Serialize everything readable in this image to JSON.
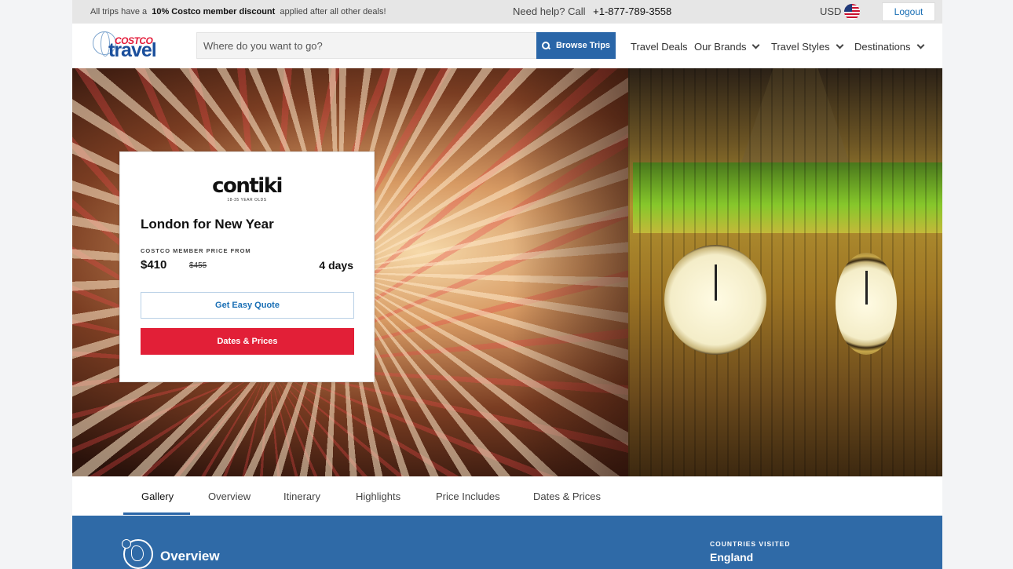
{
  "promo": {
    "prefix": "All trips have a",
    "highlight": "10% Costco member discount",
    "suffix": "applied after all other deals!"
  },
  "help": {
    "text": "Need help? Call",
    "phone": "+1-877-789-3558"
  },
  "currency": "USD",
  "logout_label": "Logout",
  "logo": {
    "top": "COSTCO",
    "bottom": "travel"
  },
  "search": {
    "placeholder": "Where do you want to go?",
    "button_label": "Browse Trips"
  },
  "nav": [
    {
      "label": "Travel Deals",
      "dropdown": false
    },
    {
      "label": "Our Brands",
      "dropdown": true
    },
    {
      "label": "Travel Styles",
      "dropdown": true
    },
    {
      "label": "Destinations",
      "dropdown": true
    }
  ],
  "trip": {
    "brand": "contiki",
    "brand_tagline": "18-35 YEAR OLDS",
    "title": "London for New Year",
    "price_label": "COSTCO MEMBER PRICE FROM",
    "price": "$410",
    "original_price": "$455",
    "duration": "4 days",
    "quote_label": "Get Easy Quote",
    "dates_label": "Dates & Prices"
  },
  "tabs": [
    {
      "label": "Gallery",
      "active": true
    },
    {
      "label": "Overview",
      "active": false
    },
    {
      "label": "Itinerary",
      "active": false
    },
    {
      "label": "Highlights",
      "active": false
    },
    {
      "label": "Price Includes",
      "active": false
    },
    {
      "label": "Dates & Prices",
      "active": false
    }
  ],
  "overview": {
    "title": "Overview",
    "countries_label": "COUNTRIES VISITED",
    "countries_value": "England"
  },
  "colors": {
    "primary_blue": "#2a66a8",
    "accent_red": "#e21f37",
    "link_blue": "#1a6fb5",
    "section_blue": "#2f6aa7"
  },
  "icons": {
    "flag": "us-flag-icon",
    "search": "search-icon",
    "dropdown": "chevron-down-icon",
    "overview": "globe-icon"
  }
}
